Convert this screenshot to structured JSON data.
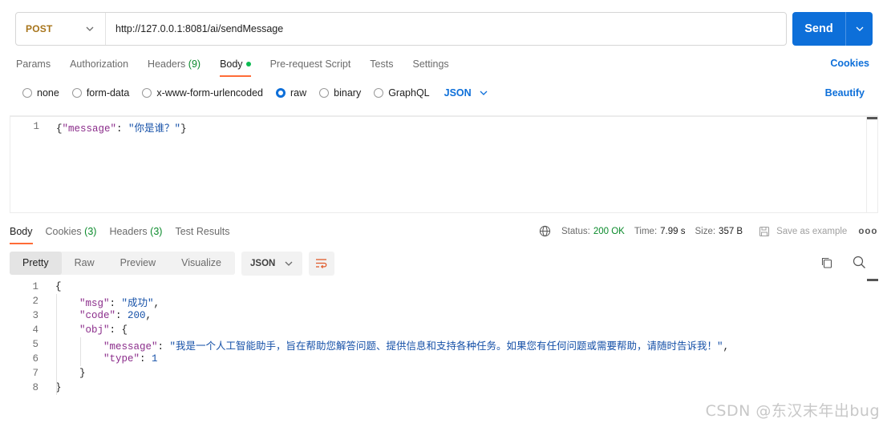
{
  "request": {
    "method": "POST",
    "url": "http://127.0.0.1:8081/ai/sendMessage",
    "send_label": "Send"
  },
  "request_tabs": [
    {
      "label": "Params"
    },
    {
      "label": "Authorization"
    },
    {
      "label": "Headers",
      "count": "(9)"
    },
    {
      "label": "Body",
      "active": true
    },
    {
      "label": "Pre-request Script"
    },
    {
      "label": "Tests"
    },
    {
      "label": "Settings"
    }
  ],
  "cookies_link": "Cookies",
  "body_types": [
    "none",
    "form-data",
    "x-www-form-urlencoded",
    "raw",
    "binary",
    "GraphQL"
  ],
  "body_type_selected": "raw",
  "body_format": "JSON",
  "beautify_label": "Beautify",
  "request_body": {
    "lines": [
      {
        "n": "1",
        "parts": [
          [
            "p",
            "{"
          ],
          [
            "k",
            "\"message\""
          ],
          [
            "p",
            ": "
          ],
          [
            "s",
            "\"你是谁？\""
          ],
          [
            "p",
            "}"
          ]
        ]
      }
    ]
  },
  "response_tabs": [
    {
      "label": "Body",
      "active": true
    },
    {
      "label": "Cookies",
      "count": "(3)"
    },
    {
      "label": "Headers",
      "count": "(3)"
    },
    {
      "label": "Test Results"
    }
  ],
  "response_status": {
    "status_label": "Status:",
    "status_value": "200 OK",
    "time_label": "Time:",
    "time_value": "7.99 s",
    "size_label": "Size:",
    "size_value": "357 B",
    "save_label": "Save as example",
    "more": "ooo"
  },
  "view_modes": [
    "Pretty",
    "Raw",
    "Preview",
    "Visualize"
  ],
  "view_mode_selected": "Pretty",
  "response_format": "JSON",
  "response_body": {
    "lines": [
      {
        "n": "1",
        "indent": 0,
        "parts": [
          [
            "p",
            "{"
          ]
        ]
      },
      {
        "n": "2",
        "indent": 1,
        "parts": [
          [
            "k",
            "\"msg\""
          ],
          [
            "p",
            ": "
          ],
          [
            "s",
            "\"成功\""
          ],
          [
            "p",
            ","
          ]
        ]
      },
      {
        "n": "3",
        "indent": 1,
        "parts": [
          [
            "k",
            "\"code\""
          ],
          [
            "p",
            ": "
          ],
          [
            "n",
            "200"
          ],
          [
            "p",
            ","
          ]
        ]
      },
      {
        "n": "4",
        "indent": 1,
        "parts": [
          [
            "k",
            "\"obj\""
          ],
          [
            "p",
            ": {"
          ]
        ]
      },
      {
        "n": "5",
        "indent": 2,
        "parts": [
          [
            "k",
            "\"message\""
          ],
          [
            "p",
            ": "
          ],
          [
            "s",
            "\"我是一个人工智能助手，旨在帮助您解答问题、提供信息和支持各种任务。如果您有任何问题或需要帮助，请随时告诉我！\""
          ],
          [
            "p",
            ","
          ]
        ]
      },
      {
        "n": "6",
        "indent": 2,
        "parts": [
          [
            "k",
            "\"type\""
          ],
          [
            "p",
            ": "
          ],
          [
            "n",
            "1"
          ]
        ]
      },
      {
        "n": "7",
        "indent": 1,
        "parts": [
          [
            "p",
            "}"
          ]
        ]
      },
      {
        "n": "8",
        "indent": 0,
        "parts": [
          [
            "p",
            "}"
          ]
        ]
      }
    ]
  },
  "watermark": "CSDN @东汉末年出bug",
  "colors": {
    "accent_blue": "#0d6fd9",
    "method_post": "#a7741a",
    "active_tab_underline": "#ff6c37",
    "status_ok": "#0a8a2b"
  }
}
